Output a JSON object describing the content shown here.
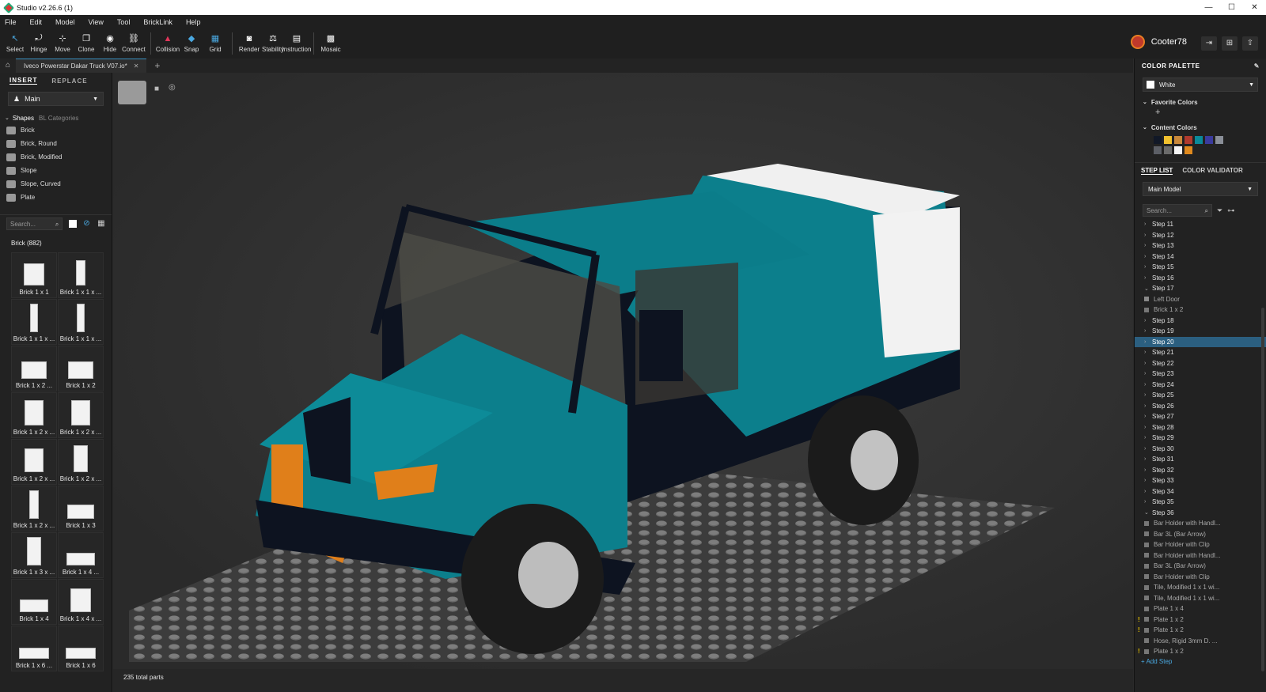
{
  "app": {
    "title": "Studio v2.26.6 (1)"
  },
  "window_controls": [
    "—",
    "☐",
    "✕"
  ],
  "menu": [
    "File",
    "Edit",
    "Model",
    "View",
    "Tool",
    "BrickLink",
    "Help"
  ],
  "toolbar": {
    "group1": [
      {
        "label": "Select",
        "icon": "select-icon",
        "glyph": "↖"
      },
      {
        "label": "Hinge",
        "icon": "hinge-icon",
        "glyph": "⤾"
      },
      {
        "label": "Move",
        "icon": "move-icon",
        "glyph": "⊹"
      },
      {
        "label": "Clone",
        "icon": "clone-icon",
        "glyph": "❐"
      },
      {
        "label": "Hide",
        "icon": "hide-icon",
        "glyph": "◉"
      },
      {
        "label": "Connect",
        "icon": "connect-icon",
        "glyph": "⛓"
      }
    ],
    "group2": [
      {
        "label": "Collision",
        "icon": "collision-icon",
        "glyph": "▲"
      },
      {
        "label": "Snap",
        "icon": "snap-icon",
        "glyph": "◆"
      },
      {
        "label": "Grid",
        "icon": "grid-icon",
        "glyph": "▦"
      }
    ],
    "group3": [
      {
        "label": "Render",
        "icon": "render-icon",
        "glyph": "◙"
      },
      {
        "label": "Stability",
        "icon": "stability-icon",
        "glyph": "⚖"
      },
      {
        "label": "Instruction",
        "icon": "instruction-icon",
        "glyph": "▤"
      }
    ],
    "group4": [
      {
        "label": "Mosaic",
        "icon": "mosaic-icon",
        "glyph": "▩"
      }
    ]
  },
  "user": {
    "name": "Cooter78"
  },
  "document": {
    "tab": "Iveco Powerstar Dakar Truck V07.io*",
    "close": "✕",
    "add": "+"
  },
  "left": {
    "tabs": [
      "INSERT",
      "REPLACE"
    ],
    "palette_dropdown": "Main",
    "shapes_tab": "Shapes",
    "bl_tab": "BL Categories",
    "categories": [
      "Brick",
      "Brick, Round",
      "Brick, Modified",
      "Slope",
      "Slope, Curved",
      "Plate"
    ],
    "search_placeholder": "Search...",
    "group_title": "Brick (882)",
    "parts": [
      {
        "name": "Brick 1 x 1",
        "w": 26,
        "h": 28
      },
      {
        "name": "Brick 1 x 1 x ...",
        "w": 12,
        "h": 32
      },
      {
        "name": "Brick 1 x 1 x ...",
        "w": 10,
        "h": 36
      },
      {
        "name": "Brick 1 x 1 x ...",
        "w": 10,
        "h": 36
      },
      {
        "name": "Brick 1 x 2 ...",
        "w": 32,
        "h": 22
      },
      {
        "name": "Brick 1 x 2",
        "w": 32,
        "h": 22
      },
      {
        "name": "Brick 1 x 2 x ...",
        "w": 24,
        "h": 32
      },
      {
        "name": "Brick 1 x 2 x ...",
        "w": 24,
        "h": 32
      },
      {
        "name": "Brick 1 x 2 x ...",
        "w": 24,
        "h": 30
      },
      {
        "name": "Brick 1 x 2 x ...",
        "w": 18,
        "h": 34
      },
      {
        "name": "Brick 1 x 2 x ...",
        "w": 12,
        "h": 36
      },
      {
        "name": "Brick 1 x 3",
        "w": 34,
        "h": 18
      },
      {
        "name": "Brick 1 x 3 x ...",
        "w": 18,
        "h": 36
      },
      {
        "name": "Brick 1 x 4 ...",
        "w": 36,
        "h": 16
      },
      {
        "name": "Brick 1 x 4",
        "w": 36,
        "h": 16
      },
      {
        "name": "Brick 1 x 4 x ...",
        "w": 26,
        "h": 30
      },
      {
        "name": "Brick 1 x 6 ...",
        "w": 38,
        "h": 14
      },
      {
        "name": "Brick 1 x 6",
        "w": 38,
        "h": 14
      }
    ]
  },
  "viewport": {
    "total_parts": "235 total parts"
  },
  "right": {
    "color_palette_title": "COLOR PALETTE",
    "selected_color": "White",
    "favorite_title": "Favorite Colors",
    "add_favorite": "+",
    "content_title": "Content Colors",
    "content_colors": [
      "#111827",
      "#f2c12e",
      "#c9883a",
      "#b03a2e",
      "#0a8a9a",
      "#3b3b9e",
      "#8a8f98",
      "#5c5f66",
      "#6b6b6b",
      "#f5f5f5",
      "#e08a1e"
    ],
    "tabs": [
      "STEP LIST",
      "COLOR VALIDATOR"
    ],
    "model_dropdown": "Main Model",
    "search_placeholder": "Search...",
    "steps": [
      {
        "t": "step",
        "label": "Step 11",
        "ch": "›"
      },
      {
        "t": "step",
        "label": "Step 12",
        "ch": "›"
      },
      {
        "t": "step",
        "label": "Step 13",
        "ch": "›"
      },
      {
        "t": "step",
        "label": "Step 14",
        "ch": "›"
      },
      {
        "t": "step",
        "label": "Step 15",
        "ch": "›"
      },
      {
        "t": "step",
        "label": "Step 16",
        "ch": "›"
      },
      {
        "t": "step",
        "label": "Step 17",
        "ch": "⌄"
      },
      {
        "t": "folder",
        "label": "Left Door"
      },
      {
        "t": "part",
        "label": "Brick 1 x 2"
      },
      {
        "t": "step",
        "label": "Step 18",
        "ch": "›"
      },
      {
        "t": "step",
        "label": "Step 19",
        "ch": "›"
      },
      {
        "t": "step",
        "label": "Step 20",
        "ch": "›",
        "sel": true
      },
      {
        "t": "step",
        "label": "Step 21",
        "ch": "›"
      },
      {
        "t": "step",
        "label": "Step 22",
        "ch": "›"
      },
      {
        "t": "step",
        "label": "Step 23",
        "ch": "›"
      },
      {
        "t": "step",
        "label": "Step 24",
        "ch": "›"
      },
      {
        "t": "step",
        "label": "Step 25",
        "ch": "›"
      },
      {
        "t": "step",
        "label": "Step 26",
        "ch": "›"
      },
      {
        "t": "step",
        "label": "Step 27",
        "ch": "›"
      },
      {
        "t": "step",
        "label": "Step 28",
        "ch": "›"
      },
      {
        "t": "step",
        "label": "Step 29",
        "ch": "›"
      },
      {
        "t": "step",
        "label": "Step 30",
        "ch": "›"
      },
      {
        "t": "step",
        "label": "Step 31",
        "ch": "›"
      },
      {
        "t": "step",
        "label": "Step 32",
        "ch": "›"
      },
      {
        "t": "step",
        "label": "Step 33",
        "ch": "›"
      },
      {
        "t": "step",
        "label": "Step 34",
        "ch": "›"
      },
      {
        "t": "step",
        "label": "Step 35",
        "ch": "›"
      },
      {
        "t": "step",
        "label": "Step 36",
        "ch": "⌄"
      },
      {
        "t": "part",
        "label": "Bar Holder with Handl..."
      },
      {
        "t": "part",
        "label": "Bar  3L (Bar Arrow)"
      },
      {
        "t": "part",
        "label": "Bar Holder with Clip"
      },
      {
        "t": "part",
        "label": "Bar Holder with Handl..."
      },
      {
        "t": "part",
        "label": "Bar  3L (Bar Arrow)"
      },
      {
        "t": "part",
        "label": "Bar Holder with Clip"
      },
      {
        "t": "part",
        "label": "Tile, Modified 1 x 1 wi..."
      },
      {
        "t": "part",
        "label": "Tile, Modified 1 x 1 wi..."
      },
      {
        "t": "part",
        "label": "Plate 1 x 4"
      },
      {
        "t": "part",
        "label": "Plate 1 x 2",
        "warn": "!"
      },
      {
        "t": "part",
        "label": "Plate 1 x 2",
        "warn": "!"
      },
      {
        "t": "part",
        "label": "Hose, Rigid 3mm D. ..."
      },
      {
        "t": "part",
        "label": "Plate 1 x 2",
        "warn": "!"
      }
    ],
    "add_step": "+ Add Step"
  }
}
